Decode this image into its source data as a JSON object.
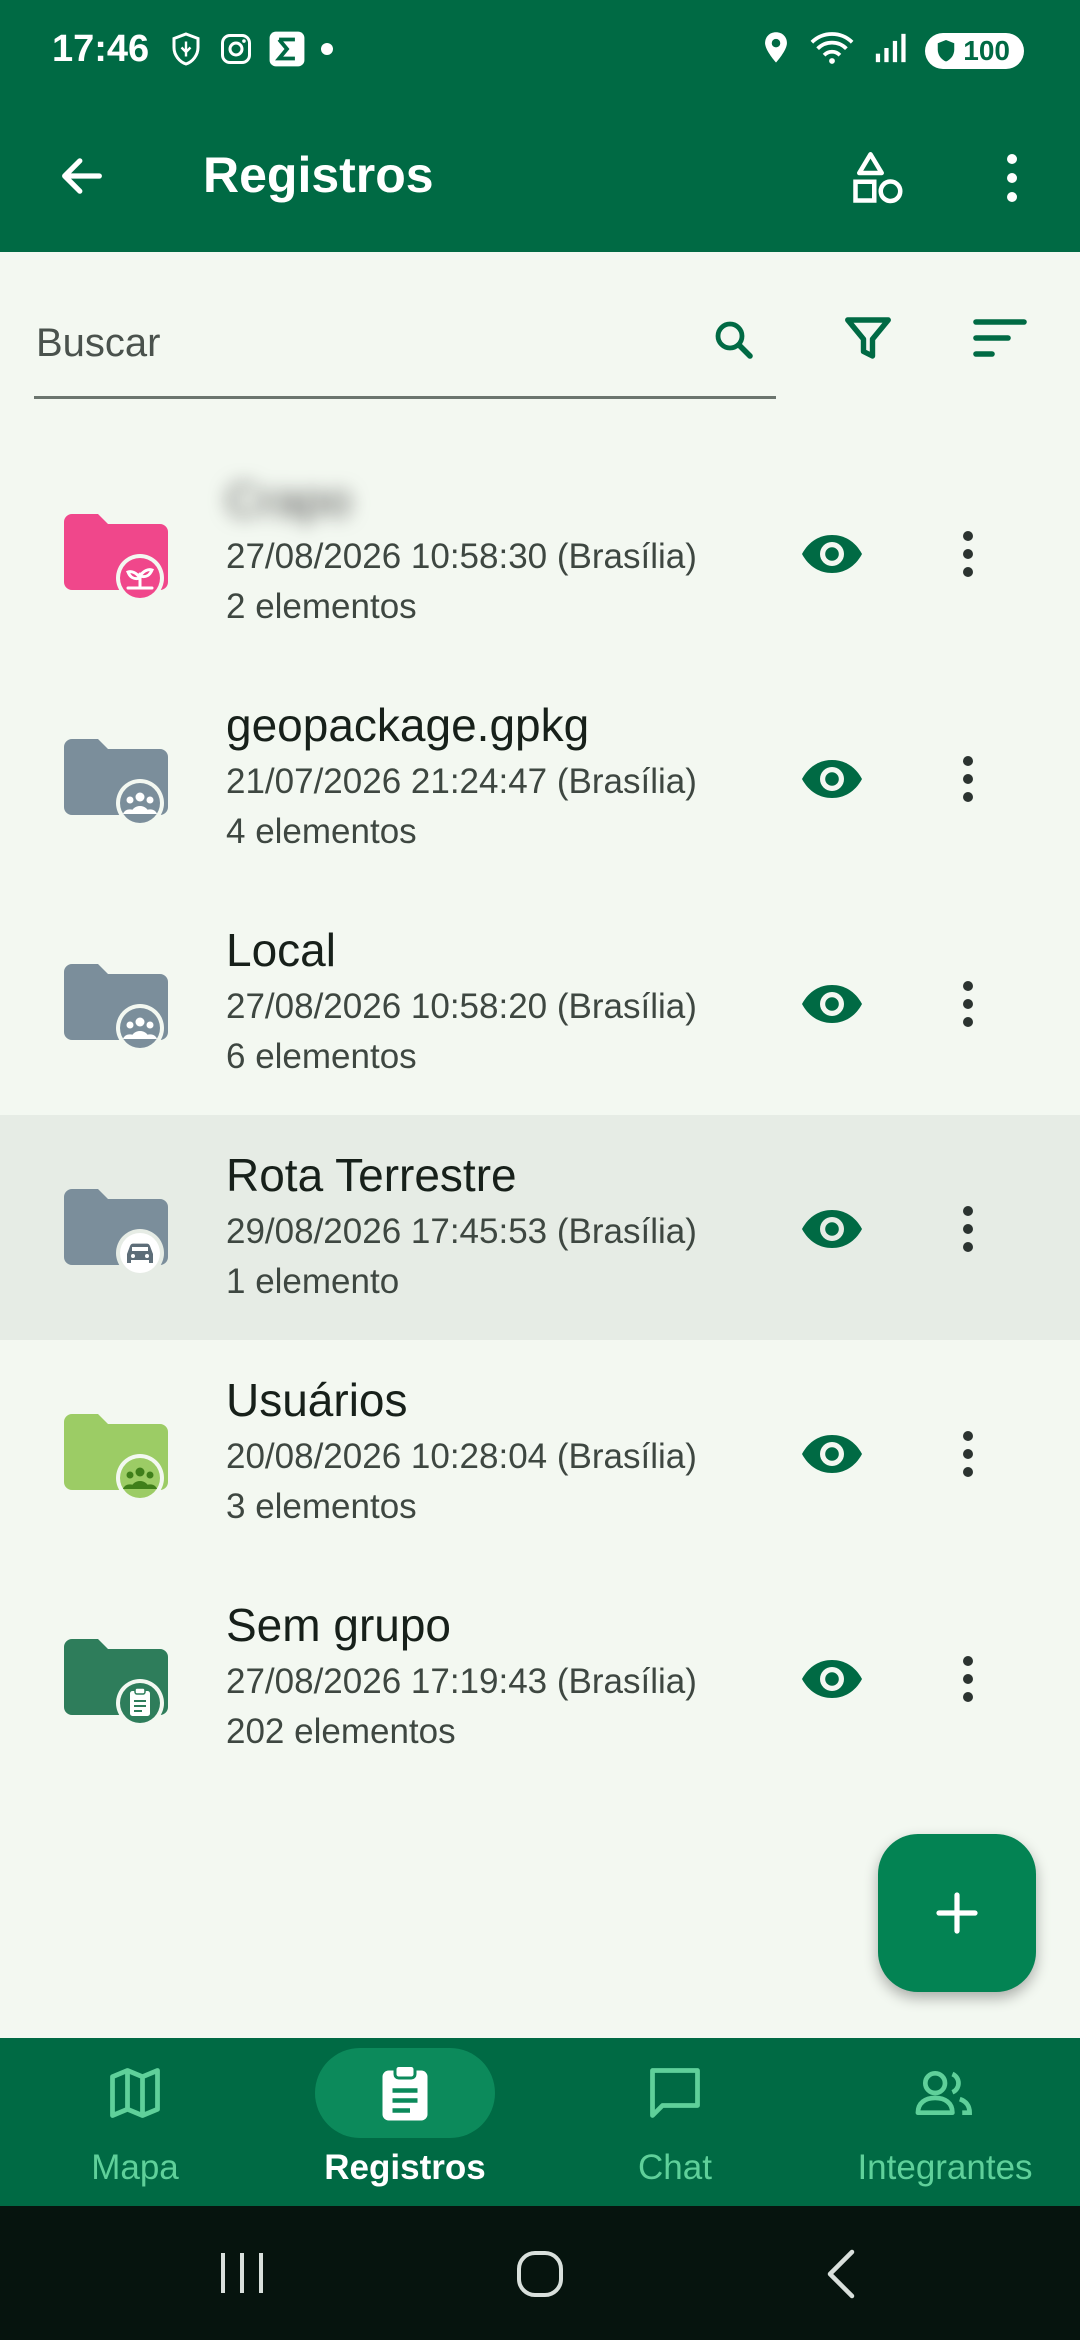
{
  "status_bar": {
    "time": "17:46",
    "battery": "100",
    "icons_left": [
      "shield-leaf-icon",
      "instagram-icon",
      "sigma-icon",
      "dot-icon"
    ],
    "icons_right": [
      "location-icon",
      "wifi-icon",
      "signal-icon",
      "battery-icon"
    ]
  },
  "app_bar": {
    "title": "Registros",
    "actions": [
      "shapes-icon",
      "more-vert-icon"
    ]
  },
  "search": {
    "placeholder": "Buscar"
  },
  "toolbar_icons": [
    "search-icon",
    "filter-icon",
    "sort-icon"
  ],
  "layers": [
    {
      "name": "Crapo",
      "date": "27/08/2026 10:58:30 (Brasília)",
      "count": "2 elementos",
      "color": "#f0478b",
      "badge": "plant-icon",
      "blurred": true,
      "selected": false
    },
    {
      "name": "geopackage.gpkg",
      "date": "21/07/2026 21:24:47 (Brasília)",
      "count": "4 elementos",
      "color": "#7b8e9b",
      "badge": "group-icon",
      "blurred": false,
      "selected": false
    },
    {
      "name": "Local",
      "date": "27/08/2026 10:58:20 (Brasília)",
      "count": "6 elementos",
      "color": "#7b8e9b",
      "badge": "group-icon",
      "blurred": false,
      "selected": false
    },
    {
      "name": "Rota Terrestre",
      "date": "29/08/2026 17:45:53 (Brasília)",
      "count": "1 elemento",
      "color": "#7b8e9b",
      "badge": "car-icon",
      "blurred": false,
      "selected": true
    },
    {
      "name": "Usuários",
      "date": "20/08/2026 10:28:04 (Brasília)",
      "count": "3 elementos",
      "color": "#9ccc65",
      "badge": "group-icon",
      "blurred": false,
      "selected": false
    },
    {
      "name": "Sem grupo",
      "date": "27/08/2026 17:19:43 (Brasília)",
      "count": "202 elementos",
      "color": "#2e7d5b",
      "badge": "clipboard-icon",
      "blurred": false,
      "selected": false
    }
  ],
  "fab": {
    "icon": "plus-icon"
  },
  "bottom_nav": [
    {
      "label": "Mapa",
      "icon": "map-icon",
      "active": false
    },
    {
      "label": "Registros",
      "icon": "clipboard-icon",
      "active": true
    },
    {
      "label": "Chat",
      "icon": "chat-icon",
      "active": false
    },
    {
      "label": "Integrantes",
      "icon": "people-icon",
      "active": false
    }
  ],
  "colors": {
    "primary": "#006a44",
    "accent": "#038353",
    "background": "#f3f8f1",
    "selected_row": "#e6ece5"
  }
}
